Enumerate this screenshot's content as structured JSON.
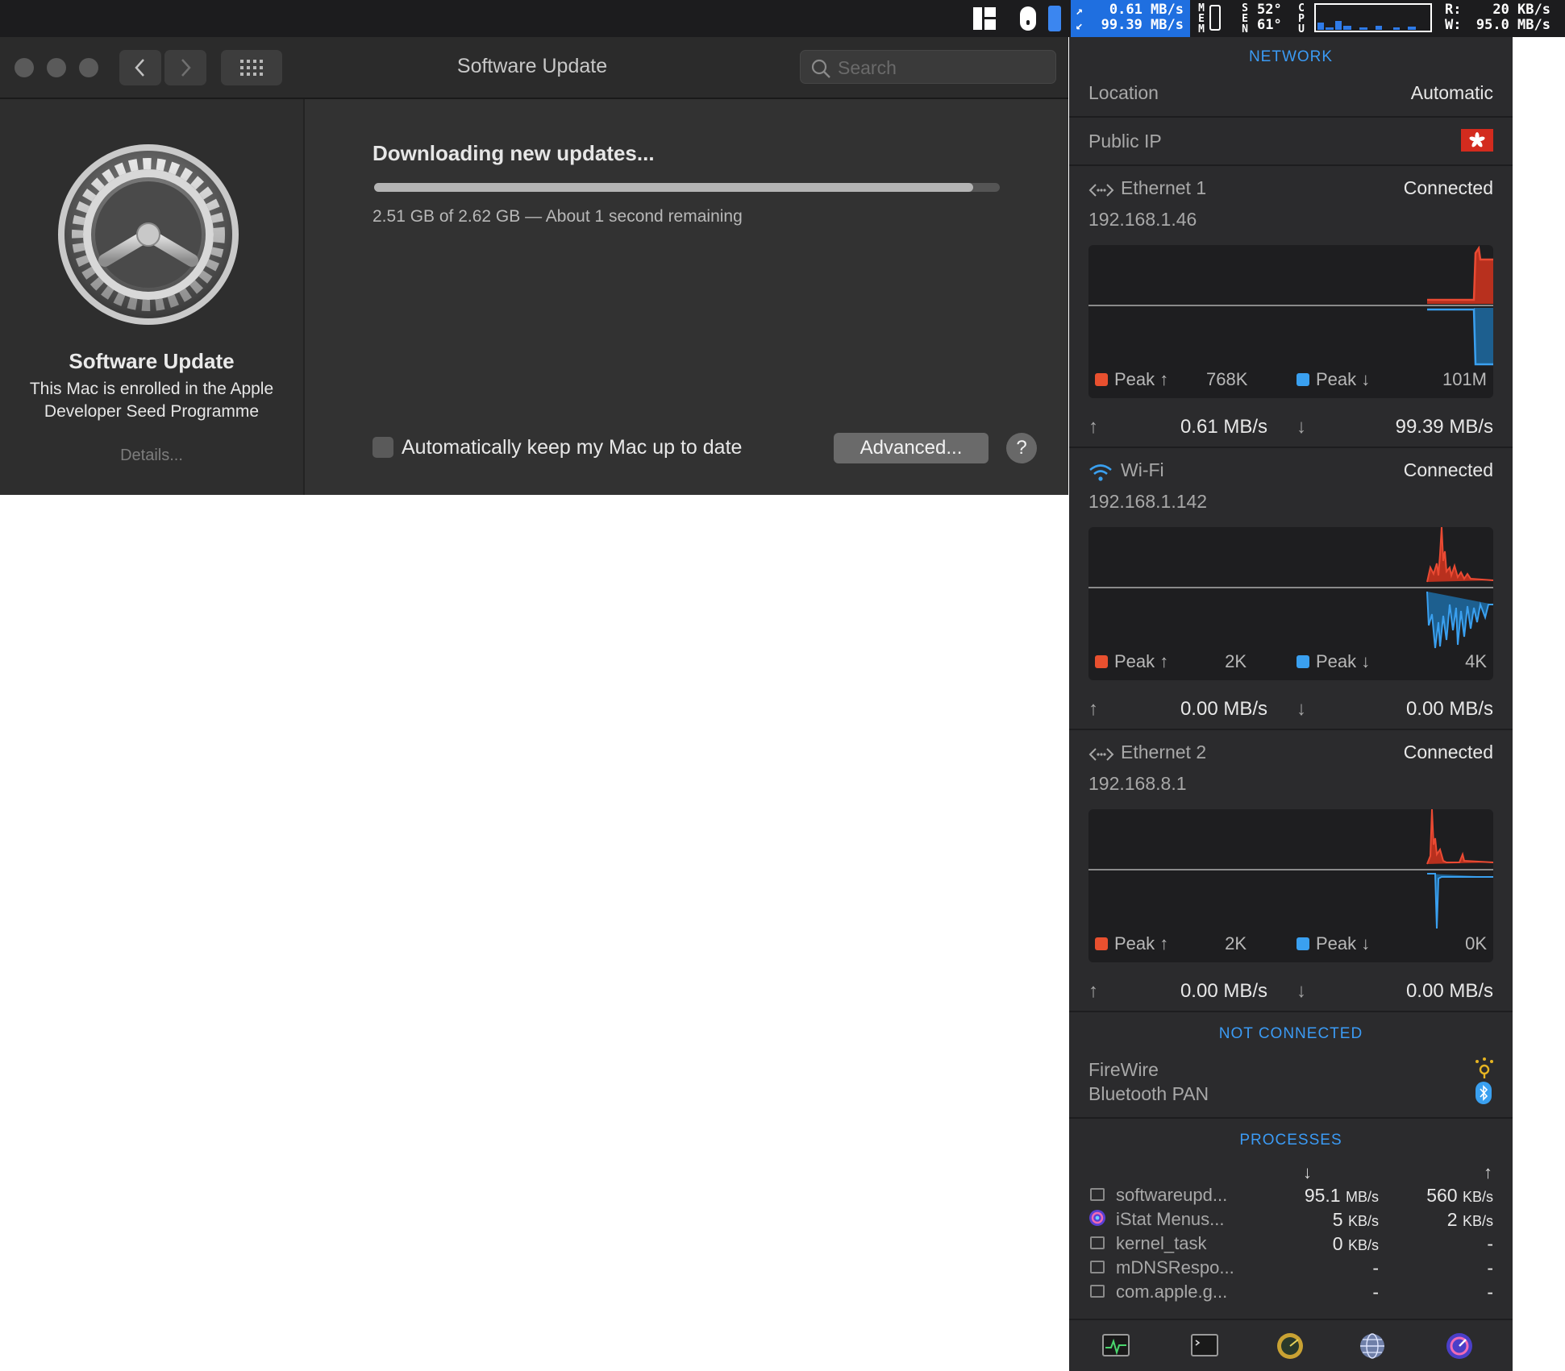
{
  "menubar": {
    "net_up": "0.61 MB/s",
    "net_down": "99.39 MB/s",
    "mem_label": "M E M",
    "sensors_label": "S E N",
    "sensor_temp_1": "52°",
    "sensor_temp_2": "61°",
    "cpu_label": "C P U",
    "disk_read_label": "R:",
    "disk_write_label": "W:",
    "disk_read": "20 KB/s",
    "disk_write": "95.0 MB/s"
  },
  "window": {
    "title": "Software Update",
    "search_placeholder": "Search"
  },
  "sidebar": {
    "title": "Software Update",
    "description": "This Mac is enrolled in the Apple Developer Seed Programme",
    "details_link": "Details..."
  },
  "main": {
    "status_title": "Downloading new updates...",
    "progress": 0.958,
    "progress_text": "2.51 GB of 2.62 GB — About 1 second remaining",
    "auto_update_label": "Automatically keep my Mac up to date",
    "auto_update_checked": false,
    "advanced_button": "Advanced...",
    "help_button": "?"
  },
  "istat": {
    "network_header": "NETWORK",
    "location_label": "Location",
    "location_value": "Automatic",
    "public_ip_label": "Public IP",
    "interfaces": [
      {
        "name": "Ethernet 1",
        "status": "Connected",
        "ip": "192.168.1.46",
        "peak_up_label": "Peak ↑",
        "peak_up": "768K",
        "peak_down_label": "Peak ↓",
        "peak_down": "101M",
        "up_speed": "0.61 MB/s",
        "down_speed": "99.39 MB/s"
      },
      {
        "name": "Wi-Fi",
        "status": "Connected",
        "ip": "192.168.1.142",
        "peak_up_label": "Peak ↑",
        "peak_up": "2K",
        "peak_down_label": "Peak ↓",
        "peak_down": "4K",
        "up_speed": "0.00 MB/s",
        "down_speed": "0.00 MB/s"
      },
      {
        "name": "Ethernet 2",
        "status": "Connected",
        "ip": "192.168.8.1",
        "peak_up_label": "Peak ↑",
        "peak_up": "2K",
        "peak_down_label": "Peak ↓",
        "peak_down": "0K",
        "up_speed": "0.00 MB/s",
        "down_speed": "0.00 MB/s"
      }
    ],
    "not_connected_header": "NOT CONNECTED",
    "not_connected": [
      "FireWire",
      "Bluetooth PAN"
    ],
    "processes_header": "PROCESSES",
    "processes": [
      {
        "name": "softwareupd...",
        "down": "95.1",
        "down_unit": "MB/s",
        "up": "560",
        "up_unit": "KB/s"
      },
      {
        "name": "iStat Menus...",
        "down": "5",
        "down_unit": "KB/s",
        "up": "2",
        "up_unit": "KB/s"
      },
      {
        "name": "kernel_task",
        "down": "0",
        "down_unit": "KB/s",
        "up": "-",
        "up_unit": ""
      },
      {
        "name": "mDNSRespo...",
        "down": "-",
        "down_unit": "",
        "up": "-",
        "up_unit": ""
      },
      {
        "name": "com.apple.g...",
        "down": "-",
        "down_unit": "",
        "up": "-",
        "up_unit": ""
      }
    ],
    "colors": {
      "upload": "#e8502f",
      "download": "#3aa0f0",
      "accent": "#3b9bf5"
    }
  }
}
